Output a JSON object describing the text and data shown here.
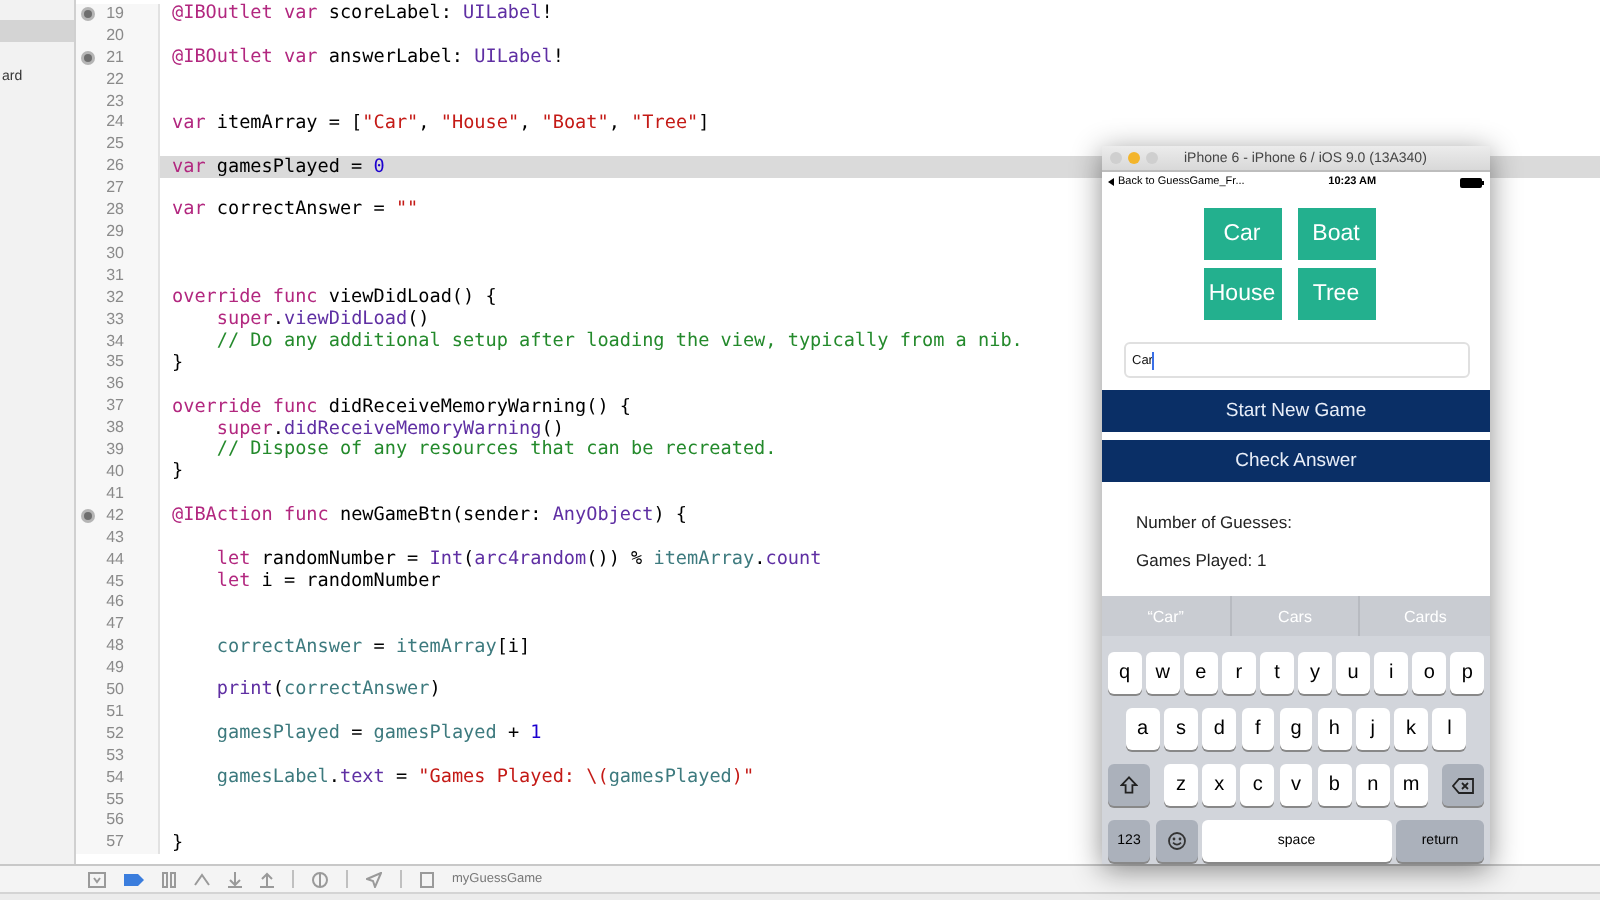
{
  "sidebar": {
    "items": [
      {
        "label": "ard"
      }
    ]
  },
  "editor": {
    "lines": [
      {
        "number": "19",
        "marker": true,
        "highlighted": false,
        "tokens": [
          {
            "kind": "keyword",
            "text": "@IBOutlet var"
          },
          {
            "kind": "plain",
            "text": " scoreLabel: "
          },
          {
            "kind": "type",
            "text": "UILabel"
          },
          {
            "kind": "plain",
            "text": "!"
          }
        ]
      },
      {
        "number": "20",
        "marker": false,
        "highlighted": false
      },
      {
        "number": "21",
        "marker": true,
        "highlighted": false,
        "tokens": [
          {
            "kind": "keyword",
            "text": "@IBOutlet var"
          },
          {
            "kind": "plain",
            "text": " answerLabel: "
          },
          {
            "kind": "type",
            "text": "UILabel"
          },
          {
            "kind": "plain",
            "text": "!"
          }
        ]
      },
      {
        "number": "22",
        "marker": false,
        "highlighted": false
      },
      {
        "number": "23",
        "marker": false,
        "highlighted": false
      },
      {
        "number": "24",
        "marker": false,
        "highlighted": false,
        "tokens": [
          {
            "kind": "keyword",
            "text": "var"
          },
          {
            "kind": "plain",
            "text": " itemArray = ["
          },
          {
            "kind": "string",
            "text": "\"Car\""
          },
          {
            "kind": "plain",
            "text": ", "
          },
          {
            "kind": "string",
            "text": "\"House\""
          },
          {
            "kind": "plain",
            "text": ", "
          },
          {
            "kind": "string",
            "text": "\"Boat\""
          },
          {
            "kind": "plain",
            "text": ", "
          },
          {
            "kind": "string",
            "text": "\"Tree\""
          },
          {
            "kind": "plain",
            "text": "]"
          }
        ]
      },
      {
        "number": "25",
        "marker": false,
        "highlighted": false
      },
      {
        "number": "26",
        "marker": false,
        "highlighted": true,
        "tokens": [
          {
            "kind": "keyword",
            "text": "var"
          },
          {
            "kind": "plain",
            "text": " gamesPlayed = "
          },
          {
            "kind": "number",
            "text": "0"
          }
        ]
      },
      {
        "number": "27",
        "marker": false,
        "highlighted": false
      },
      {
        "number": "28",
        "marker": false,
        "highlighted": false,
        "tokens": [
          {
            "kind": "keyword",
            "text": "var"
          },
          {
            "kind": "plain",
            "text": " correctAnswer = "
          },
          {
            "kind": "string",
            "text": "\"\""
          }
        ]
      },
      {
        "number": "29",
        "marker": false,
        "highlighted": false
      },
      {
        "number": "30",
        "marker": false,
        "highlighted": false
      },
      {
        "number": "31",
        "marker": false,
        "highlighted": false
      },
      {
        "number": "32",
        "marker": false,
        "highlighted": false,
        "tokens": [
          {
            "kind": "keyword",
            "text": "override func"
          },
          {
            "kind": "plain",
            "text": " viewDidLoad() {"
          }
        ]
      },
      {
        "number": "33",
        "marker": false,
        "highlighted": false,
        "tokens": [
          {
            "kind": "keyword",
            "text": "    super"
          },
          {
            "kind": "plain",
            "text": "."
          },
          {
            "kind": "type",
            "text": "viewDidLoad"
          },
          {
            "kind": "plain",
            "text": "()"
          }
        ]
      },
      {
        "number": "34",
        "marker": false,
        "highlighted": false,
        "tokens": [
          {
            "kind": "comment",
            "text": "    // Do any additional setup after loading the view, typically from a nib."
          }
        ]
      },
      {
        "number": "35",
        "marker": false,
        "highlighted": false,
        "tokens": [
          {
            "kind": "plain",
            "text": "}"
          }
        ]
      },
      {
        "number": "36",
        "marker": false,
        "highlighted": false
      },
      {
        "number": "37",
        "marker": false,
        "highlighted": false,
        "tokens": [
          {
            "kind": "keyword",
            "text": "override func"
          },
          {
            "kind": "plain",
            "text": " didReceiveMemoryWarning() {"
          }
        ]
      },
      {
        "number": "38",
        "marker": false,
        "highlighted": false,
        "tokens": [
          {
            "kind": "keyword",
            "text": "    super"
          },
          {
            "kind": "plain",
            "text": "."
          },
          {
            "kind": "type",
            "text": "didReceiveMemoryWarning"
          },
          {
            "kind": "plain",
            "text": "()"
          }
        ]
      },
      {
        "number": "39",
        "marker": false,
        "highlighted": false,
        "tokens": [
          {
            "kind": "comment",
            "text": "    // Dispose of any resources that can be recreated."
          }
        ]
      },
      {
        "number": "40",
        "marker": false,
        "highlighted": false,
        "tokens": [
          {
            "kind": "plain",
            "text": "}"
          }
        ]
      },
      {
        "number": "41",
        "marker": false,
        "highlighted": false
      },
      {
        "number": "42",
        "marker": true,
        "highlighted": false,
        "tokens": [
          {
            "kind": "keyword",
            "text": "@IBAction func"
          },
          {
            "kind": "plain",
            "text": " newGameBtn(sender: "
          },
          {
            "kind": "type",
            "text": "AnyObject"
          },
          {
            "kind": "plain",
            "text": ") {"
          }
        ]
      },
      {
        "number": "43",
        "marker": false,
        "highlighted": false
      },
      {
        "number": "44",
        "marker": false,
        "highlighted": false,
        "tokens": [
          {
            "kind": "keyword",
            "text": "    let"
          },
          {
            "kind": "plain",
            "text": " randomNumber = "
          },
          {
            "kind": "type",
            "text": "Int"
          },
          {
            "kind": "plain",
            "text": "("
          },
          {
            "kind": "type",
            "text": "arc4random"
          },
          {
            "kind": "plain",
            "text": "()) % "
          },
          {
            "kind": "identifier",
            "text": "itemArray"
          },
          {
            "kind": "plain",
            "text": "."
          },
          {
            "kind": "type",
            "text": "count"
          }
        ]
      },
      {
        "number": "45",
        "marker": false,
        "highlighted": false,
        "tokens": [
          {
            "kind": "keyword",
            "text": "    let"
          },
          {
            "kind": "plain",
            "text": " i = randomNumber"
          }
        ]
      },
      {
        "number": "46",
        "marker": false,
        "highlighted": false
      },
      {
        "number": "47",
        "marker": false,
        "highlighted": false
      },
      {
        "number": "48",
        "marker": false,
        "highlighted": false,
        "tokens": [
          {
            "kind": "identifier",
            "text": "    correctAnswer"
          },
          {
            "kind": "plain",
            "text": " = "
          },
          {
            "kind": "identifier",
            "text": "itemArray"
          },
          {
            "kind": "plain",
            "text": "[i]"
          }
        ]
      },
      {
        "number": "49",
        "marker": false,
        "highlighted": false
      },
      {
        "number": "50",
        "marker": false,
        "highlighted": false,
        "tokens": [
          {
            "kind": "type",
            "text": "    print"
          },
          {
            "kind": "plain",
            "text": "("
          },
          {
            "kind": "identifier",
            "text": "correctAnswer"
          },
          {
            "kind": "plain",
            "text": ")"
          }
        ]
      },
      {
        "number": "51",
        "marker": false,
        "highlighted": false
      },
      {
        "number": "52",
        "marker": false,
        "highlighted": false,
        "tokens": [
          {
            "kind": "identifier",
            "text": "    gamesPlayed"
          },
          {
            "kind": "plain",
            "text": " = "
          },
          {
            "kind": "identifier",
            "text": "gamesPlayed"
          },
          {
            "kind": "plain",
            "text": " + "
          },
          {
            "kind": "number",
            "text": "1"
          }
        ]
      },
      {
        "number": "53",
        "marker": false,
        "highlighted": false
      },
      {
        "number": "54",
        "marker": false,
        "highlighted": false,
        "tokens": [
          {
            "kind": "identifier",
            "text": "    gamesLabel"
          },
          {
            "kind": "plain",
            "text": "."
          },
          {
            "kind": "type",
            "text": "text"
          },
          {
            "kind": "plain",
            "text": " = "
          },
          {
            "kind": "string",
            "text": "\"Games Played: \\("
          },
          {
            "kind": "identifier",
            "text": "gamesPlayed"
          },
          {
            "kind": "string",
            "text": ")\""
          }
        ]
      },
      {
        "number": "55",
        "marker": false,
        "highlighted": false
      },
      {
        "number": "56",
        "marker": false,
        "highlighted": false
      },
      {
        "number": "57",
        "marker": false,
        "highlighted": false,
        "tokens": [
          {
            "kind": "plain",
            "text": "}"
          }
        ]
      }
    ]
  },
  "debug_bar": {
    "scheme": "myGuessGame"
  },
  "simulator": {
    "title": "iPhone 6 - iPhone 6 / iOS 9.0 (13A340)",
    "status_bar": {
      "back": "Back to GuessGame_Fr...",
      "time": "10:23 AM"
    },
    "tiles": [
      {
        "label": "Car"
      },
      {
        "label": "Boat"
      },
      {
        "label": "House"
      },
      {
        "label": "Tree"
      }
    ],
    "answer_field": {
      "value": "Car"
    },
    "buttons": [
      "Start New Game",
      "Check Answer"
    ],
    "labels": [
      "Number of Guesses:",
      "Games Played: 1"
    ],
    "keyboard": {
      "suggestions": [
        "“Car”",
        "Cars",
        "Cards"
      ],
      "rows": [
        {
          "keys": [
            {
              "kind": "letter",
              "label": "q"
            },
            {
              "kind": "letter",
              "label": "w"
            },
            {
              "kind": "letter",
              "label": "e"
            },
            {
              "kind": "letter",
              "label": "r"
            },
            {
              "kind": "letter",
              "label": "t"
            },
            {
              "kind": "letter",
              "label": "y"
            },
            {
              "kind": "letter",
              "label": "u"
            },
            {
              "kind": "letter",
              "label": "i"
            },
            {
              "kind": "letter",
              "label": "o"
            },
            {
              "kind": "letter",
              "label": "p"
            }
          ]
        },
        {
          "keys": [
            {
              "kind": "letter",
              "label": "a"
            },
            {
              "kind": "letter",
              "label": "s"
            },
            {
              "kind": "letter",
              "label": "d"
            },
            {
              "kind": "letter",
              "label": "f"
            },
            {
              "kind": "letter",
              "label": "g"
            },
            {
              "kind": "letter",
              "label": "h"
            },
            {
              "kind": "letter",
              "label": "j"
            },
            {
              "kind": "letter",
              "label": "k"
            },
            {
              "kind": "letter",
              "label": "l"
            }
          ]
        },
        {
          "keys": [
            {
              "kind": "shift"
            },
            {
              "kind": "letter",
              "label": "z"
            },
            {
              "kind": "letter",
              "label": "x"
            },
            {
              "kind": "letter",
              "label": "c"
            },
            {
              "kind": "letter",
              "label": "v"
            },
            {
              "kind": "letter",
              "label": "b"
            },
            {
              "kind": "letter",
              "label": "n"
            },
            {
              "kind": "letter",
              "label": "m"
            },
            {
              "kind": "delete"
            }
          ]
        },
        {
          "keys": [
            {
              "kind": "mode",
              "label": "123"
            },
            {
              "kind": "emoji"
            },
            {
              "kind": "space",
              "label": "space"
            },
            {
              "kind": "return",
              "label": "return"
            }
          ]
        }
      ]
    }
  }
}
